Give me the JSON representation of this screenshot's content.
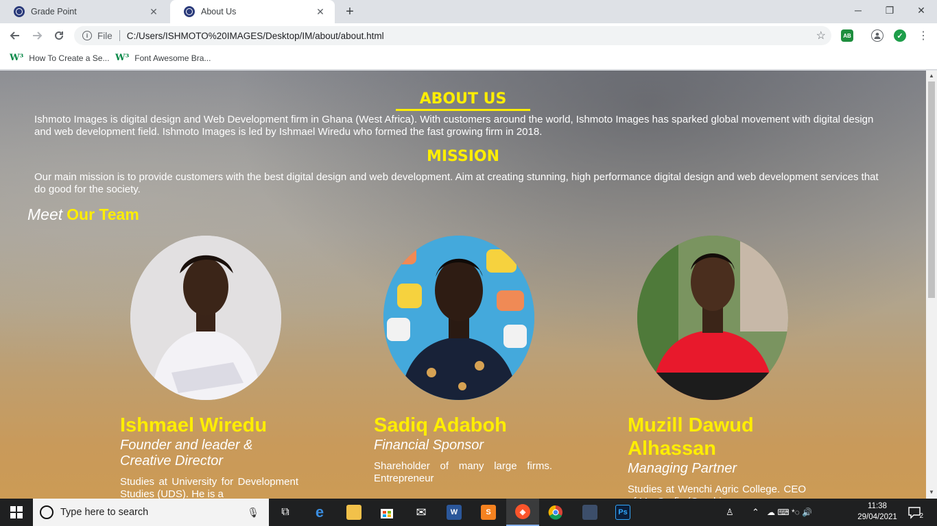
{
  "browser": {
    "tabs": [
      {
        "title": "Grade Point"
      },
      {
        "title": "About Us"
      }
    ],
    "new_tab_symbol": "+",
    "close_symbol": "✕",
    "window": {
      "minimize": "─",
      "restore": "❐",
      "close": "✕"
    },
    "address": {
      "scheme": "File",
      "url": "C:/Users/ISHMOTO%20IMAGES/Desktop/IM/about/about.html",
      "info_symbol": "i"
    },
    "extensions": [
      {
        "name": "ab-extension-icon",
        "label": "AB",
        "color": "#1e8e3e"
      },
      {
        "name": "shield-check-icon",
        "label": "✓",
        "color": "#1e9e4a"
      }
    ],
    "bookmarks": [
      {
        "label": "How To Create a Se..."
      },
      {
        "label": "Font Awesome Bra..."
      }
    ]
  },
  "page": {
    "about_heading": "ABOUT US",
    "about_text": "Ishmoto Images is digital design and Web Development firm in Ghana (West Africa). With customers around the world, Ishmoto Images has sparked global movement with digital design and web development field. Ishmoto Images is led by Ishmael Wiredu who formed the fast growing firm in 2018.",
    "mission_heading": "MISSION",
    "mission_text": "Our main mission is to provide customers with the best digital design and web development. Aim at creating stunning, high performance digital design and web development services that do good for the society.",
    "team_heading_prefix": "Meet",
    "team_heading_main": "Our Team",
    "team": [
      {
        "name": "Ishmael Wiredu",
        "role": "Founder and leader & Creative Director",
        "bio": "Studies at University for Development Studies (UDS). He is a"
      },
      {
        "name": "Sadiq Adaboh",
        "role": "Financial Sponsor",
        "bio": "Shareholder of many large firms. Entrepreneur"
      },
      {
        "name": "Muzill Dawud Alhassan",
        "role": "Managing Partner",
        "bio": "Studies at Wenchi Agric College. CEO of MurGrafix (Graphic"
      }
    ],
    "accent_color": "#ffee00"
  },
  "taskbar": {
    "search_placeholder": "Type here to search",
    "time": "11:38",
    "date": "29/04/2021",
    "notification_count": "2",
    "apps": [
      {
        "name": "task-view-icon",
        "label": "⧉"
      },
      {
        "name": "edge-icon",
        "label": "e"
      },
      {
        "name": "file-explorer-icon",
        "label": ""
      },
      {
        "name": "store-icon",
        "label": ""
      },
      {
        "name": "mail-icon",
        "label": "✉"
      },
      {
        "name": "word-icon",
        "label": "W"
      },
      {
        "name": "sublime-icon",
        "label": "S"
      },
      {
        "name": "brave-icon",
        "label": "◈"
      },
      {
        "name": "chrome-icon",
        "label": ""
      },
      {
        "name": "game-icon",
        "label": ""
      },
      {
        "name": "photoshop-icon",
        "label": "Ps"
      }
    ]
  }
}
